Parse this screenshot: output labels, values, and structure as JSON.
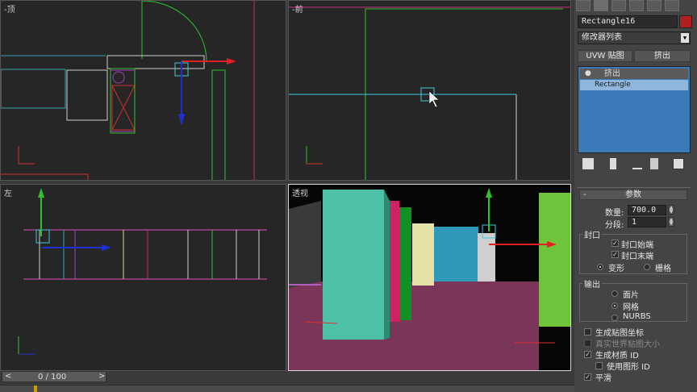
{
  "viewports": {
    "top_left_label": "-顶",
    "top_right_label": "-前",
    "bottom_left_label": "左",
    "bottom_right_label": "透视"
  },
  "panel": {
    "object_name": "Rectangle16",
    "object_color": "#b21f1f",
    "modifier_list": "修改器列表",
    "uvw_button": "UVW 贴图",
    "extrude_button": "挤出",
    "stack_items": [
      "挤出",
      "Rectangle"
    ],
    "rollout_title": "参数",
    "amount_label": "数量:",
    "amount_value": "700.0",
    "segments_label": "分段:",
    "segments_value": "1",
    "cap_group": "封口",
    "cap_start": "封口始端",
    "cap_end": "封口末端",
    "morph": "变形",
    "grid": "栅格",
    "output_group": "输出",
    "patch": "面片",
    "mesh": "网格",
    "nurbs": "NURBS",
    "gen_map_coords": "生成贴图坐标",
    "real_world_size": "真实世界贴图大小",
    "gen_mat_ids": "生成材质 ID",
    "use_shape_ids": "使用图形 ID",
    "smooth": "平滑"
  },
  "timeline": {
    "frame_text": "0 / 100",
    "prev_arrow": "<",
    "next_arrow": ">"
  },
  "icons": [
    "create-icon",
    "modify-icon",
    "hierarchy-icon",
    "motion-icon",
    "display-icon",
    "utilities-icon",
    "pin-stack-icon",
    "show-end-result-icon",
    "make-unique-icon",
    "remove-modifier-icon",
    "configure-sets-icon",
    "light-bulb-icon"
  ]
}
